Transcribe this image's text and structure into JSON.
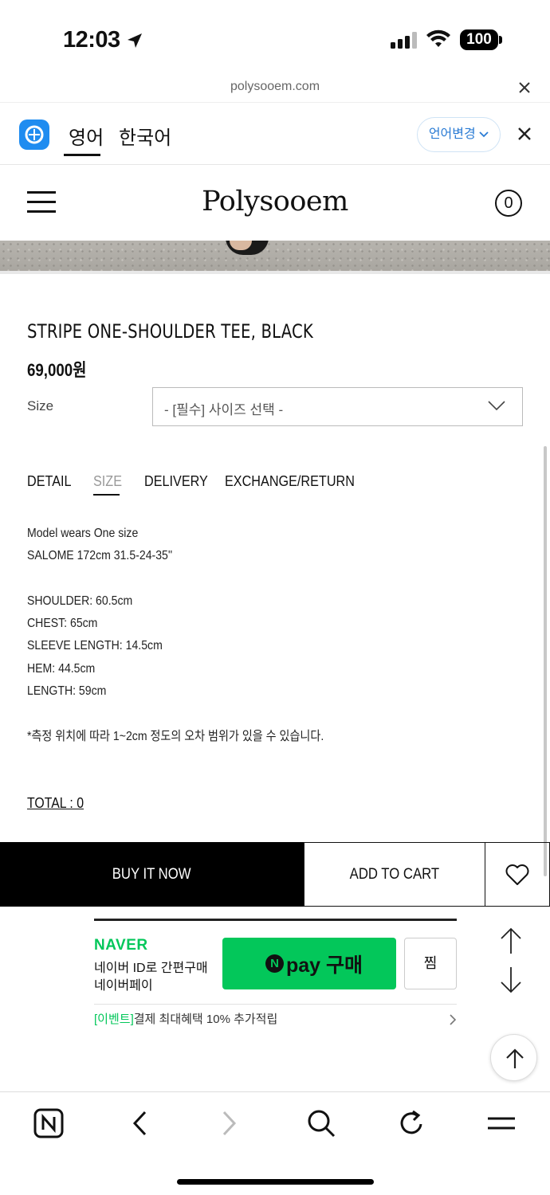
{
  "status": {
    "time": "12:03",
    "battery": "100"
  },
  "browser": {
    "url": "polysooem.com"
  },
  "translate": {
    "lang_active": "영어",
    "lang_other": "한국어",
    "change_label": "언어변경"
  },
  "site": {
    "logo": "Polysooem",
    "cart_count": "0"
  },
  "product": {
    "title": "STRIPE ONE-SHOULDER TEE, BLACK",
    "price": "69,000원",
    "size_label": "Size",
    "size_select": "- [필수] 사이즈 선택 -"
  },
  "tabs": [
    "DETAIL",
    "SIZE",
    "DELIVERY",
    "EXCHANGE/RETURN"
  ],
  "size_info": {
    "model_line1": "Model wears One size",
    "model_line2": "SALOME 172cm 31.5-24-35''",
    "shoulder": "SHOULDER: 60.5cm",
    "chest": "CHEST: 65cm",
    "sleeve": "SLEEVE LENGTH: 14.5cm",
    "hem": "HEM: 44.5cm",
    "length": "LENGTH: 59cm",
    "note": "*측정 위치에 따라 1~2cm 정도의 오차 범위가 있을 수 있습니다."
  },
  "total": "TOTAL : 0",
  "actions": {
    "buy_now": "BUY IT NOW",
    "add_to_cart": "ADD TO CART"
  },
  "naverpay": {
    "brand": "NAVER",
    "line1": "네이버 ID로 간편구매",
    "line2": "네이버페이",
    "button_n": "N",
    "button_label": "pay 구매",
    "zzim": "찜",
    "event_tag": "[이벤트]",
    "event_text": "결제 최대혜택 10% 추가적립"
  },
  "colors": {
    "naver_green": "#03c75a",
    "translate_blue": "#2a7bd4"
  }
}
